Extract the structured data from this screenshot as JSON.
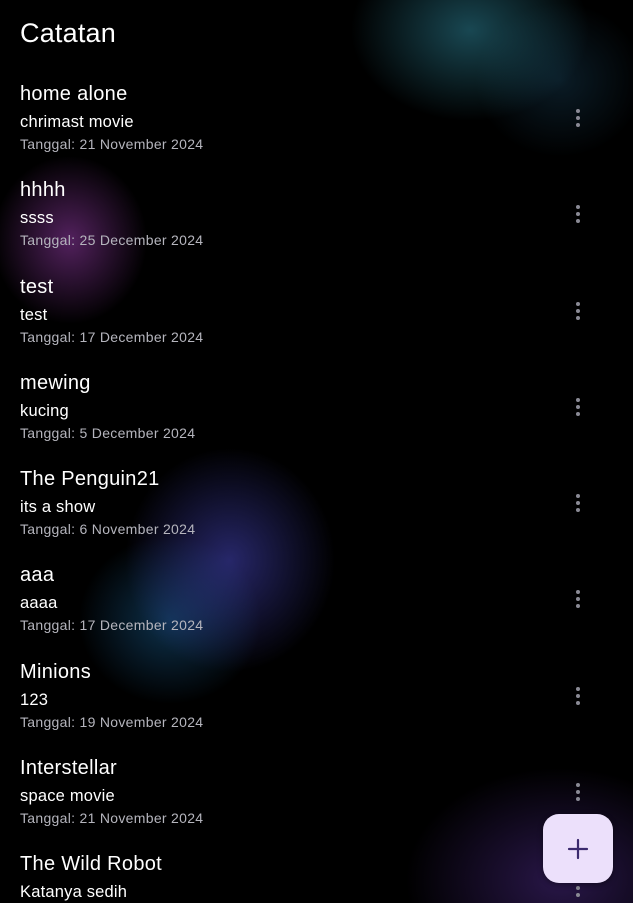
{
  "app": {
    "title": "Catatan"
  },
  "notes": [
    {
      "title": "home alone",
      "subtitle": "chrimast movie",
      "date": "Tanggal: 21 November 2024"
    },
    {
      "title": "hhhh",
      "subtitle": "ssss",
      "date": "Tanggal: 25 December 2024"
    },
    {
      "title": "test",
      "subtitle": "test",
      "date": "Tanggal: 17 December 2024"
    },
    {
      "title": "mewing",
      "subtitle": "kucing",
      "date": "Tanggal: 5 December 2024"
    },
    {
      "title": "The Penguin21",
      "subtitle": "its a show",
      "date": "Tanggal: 6 November 2024"
    },
    {
      "title": "aaa",
      "subtitle": "aaaa",
      "date": "Tanggal: 17 December 2024"
    },
    {
      "title": "Minions",
      "subtitle": "123",
      "date": "Tanggal: 19 November 2024"
    },
    {
      "title": "Interstellar",
      "subtitle": "space movie",
      "date": "Tanggal: 21 November 2024"
    },
    {
      "title": "The Wild Robot",
      "subtitle": "Katanya sedih",
      "date": ""
    }
  ],
  "icons": {
    "note_menu": "more-vertical-icon",
    "fab": "plus-icon"
  },
  "colors": {
    "background": "#000000",
    "fab_background": "#ece0fb",
    "fab_icon": "#3b2a6e",
    "date_text": "#b5b5bd",
    "menu_icon": "#8a8a95"
  }
}
